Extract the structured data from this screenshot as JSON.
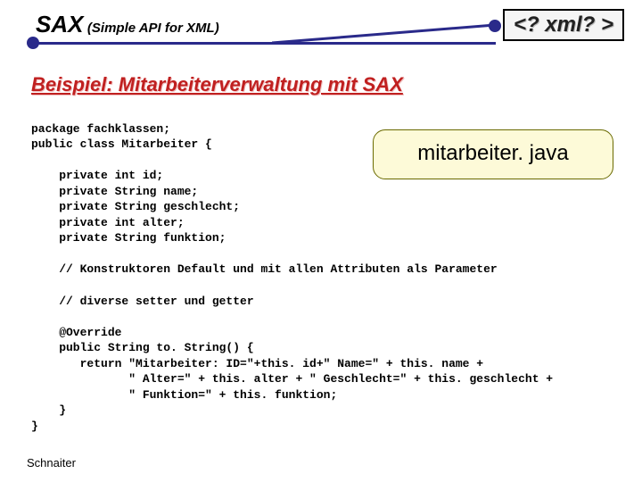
{
  "header": {
    "title_main": "SAX",
    "title_sub": "(Simple API for XML)",
    "xml_badge": "<? xml? >"
  },
  "subtitle": "Beispiel: Mitarbeiterverwaltung mit SAX",
  "filename": "mitarbeiter. java",
  "code": {
    "line01": "package fachklassen;",
    "line02": "public class Mitarbeiter {",
    "line03": "",
    "line04": "    private int id;",
    "line05": "    private String name;",
    "line06": "    private String geschlecht;",
    "line07": "    private int alter;",
    "line08": "    private String funktion;",
    "line09": "",
    "line10": "    // Konstruktoren Default und mit allen Attributen als Parameter",
    "line11": "",
    "line12": "    // diverse setter und getter",
    "line13": "",
    "line14": "    @Override",
    "line15": "    public String to. String() {",
    "line16": "       return \"Mitarbeiter: ID=\"+this. id+\" Name=\" + this. name +",
    "line17": "              \" Alter=\" + this. alter + \" Geschlecht=\" + this. geschlecht +",
    "line18": "              \" Funktion=\" + this. funktion;",
    "line19": "    }",
    "line20": "}"
  },
  "footer": "Schnaiter"
}
